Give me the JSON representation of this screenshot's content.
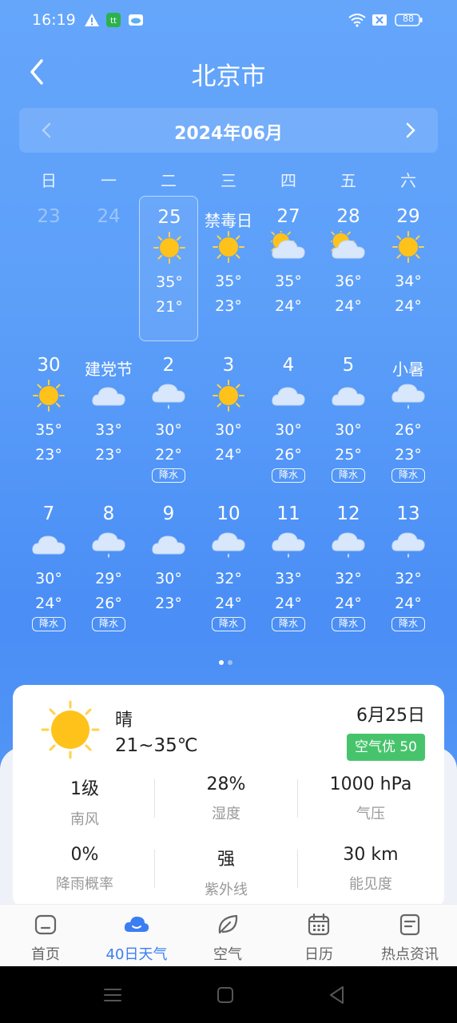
{
  "status": {
    "time": "16:19",
    "battery": "88"
  },
  "header": {
    "city": "北京市"
  },
  "calendar": {
    "month_title": "2024年06月",
    "weekdays": [
      "日",
      "一",
      "二",
      "三",
      "四",
      "五",
      "六"
    ],
    "rain_label": "降水",
    "rows": [
      [
        {
          "day": "23",
          "faded": true
        },
        {
          "day": "24",
          "faded": true
        },
        {
          "day": "25",
          "icon": "sunny",
          "hi": "35°",
          "lo": "21°",
          "selected": true
        },
        {
          "day": "禁毒日",
          "festival": true,
          "icon": "sunny",
          "hi": "35°",
          "lo": "23°"
        },
        {
          "day": "27",
          "icon": "partly-cloudy",
          "hi": "35°",
          "lo": "24°"
        },
        {
          "day": "28",
          "icon": "partly-cloudy",
          "hi": "36°",
          "lo": "24°"
        },
        {
          "day": "29",
          "icon": "sunny",
          "hi": "34°",
          "lo": "24°"
        }
      ],
      [
        {
          "day": "30",
          "icon": "sunny",
          "hi": "35°",
          "lo": "23°"
        },
        {
          "day": "建党节",
          "festival": true,
          "icon": "cloudy",
          "hi": "33°",
          "lo": "23°"
        },
        {
          "day": "2",
          "icon": "rain",
          "hi": "30°",
          "lo": "22°",
          "rain": true
        },
        {
          "day": "3",
          "icon": "sunny",
          "hi": "30°",
          "lo": "24°"
        },
        {
          "day": "4",
          "icon": "cloudy",
          "hi": "30°",
          "lo": "26°",
          "rain": true
        },
        {
          "day": "5",
          "icon": "cloudy",
          "hi": "30°",
          "lo": "25°",
          "rain": true
        },
        {
          "day": "小暑",
          "festival": true,
          "icon": "rain",
          "hi": "26°",
          "lo": "23°",
          "rain": true
        }
      ],
      [
        {
          "day": "7",
          "icon": "cloudy",
          "hi": "30°",
          "lo": "24°",
          "rain": true
        },
        {
          "day": "8",
          "icon": "rain",
          "hi": "29°",
          "lo": "26°",
          "rain": true
        },
        {
          "day": "9",
          "icon": "cloudy",
          "hi": "30°",
          "lo": "23°"
        },
        {
          "day": "10",
          "icon": "rain",
          "hi": "32°",
          "lo": "24°",
          "rain": true
        },
        {
          "day": "11",
          "icon": "rain",
          "hi": "33°",
          "lo": "24°",
          "rain": true
        },
        {
          "day": "12",
          "icon": "rain",
          "hi": "32°",
          "lo": "24°",
          "rain": true
        },
        {
          "day": "13",
          "icon": "rain",
          "hi": "32°",
          "lo": "24°",
          "rain": true
        }
      ]
    ],
    "page_indicator": {
      "count": 2,
      "active": 0
    }
  },
  "detail": {
    "icon": "sunny",
    "condition": "晴",
    "range": "21~35℃",
    "date": "6月25日",
    "aqi": "空气优 50",
    "stats": [
      {
        "value": "1级",
        "label": "南风"
      },
      {
        "value": "28%",
        "label": "湿度"
      },
      {
        "value": "1000 hPa",
        "label": "气压"
      },
      {
        "value": "0%",
        "label": "降雨概率"
      },
      {
        "value": "强",
        "label": "紫外线"
      },
      {
        "value": "30 km",
        "label": "能见度"
      }
    ]
  },
  "tabs": [
    {
      "label": "首页",
      "icon": "home-icon"
    },
    {
      "label": "40日天气",
      "icon": "cloud-icon",
      "active": true
    },
    {
      "label": "空气",
      "icon": "leaf-icon"
    },
    {
      "label": "日历",
      "icon": "calendar-icon"
    },
    {
      "label": "热点资讯",
      "icon": "news-icon"
    }
  ],
  "colors": {
    "accent": "#3b7ef3",
    "aqi_good": "#47c46b",
    "sun": "#ffc21a"
  }
}
